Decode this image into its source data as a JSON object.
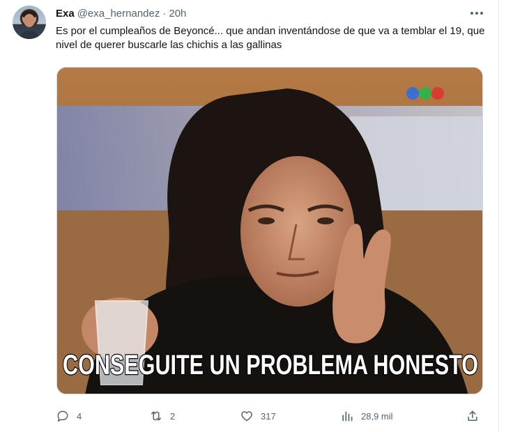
{
  "tweet": {
    "author_name": "Exa",
    "handle": "@exa_hernandez",
    "separator": "·",
    "time": "20h",
    "text": "Es por el cumpleaños de Beyoncé... que andan inventándose de que va a temblar el 19, que nivel de querer buscarle las chichis a las gallinas",
    "media": {
      "caption": "CONSEGUITE UN PROBLEMA HONESTO"
    }
  },
  "actions": {
    "reply_count": "4",
    "retweet_count": "2",
    "like_count": "317",
    "view_count": "28,9 mil"
  },
  "icons": {
    "reply": "reply-icon",
    "retweet": "retweet-icon",
    "like": "heart-icon",
    "views": "views-icon",
    "share": "share-icon",
    "more": "more-icon",
    "channel_logo": "tv-logo-icon"
  },
  "colors": {
    "text_primary": "#0f1419",
    "text_secondary": "#536471",
    "border": "#e7e9ea",
    "caption_text": "#ffffff"
  }
}
